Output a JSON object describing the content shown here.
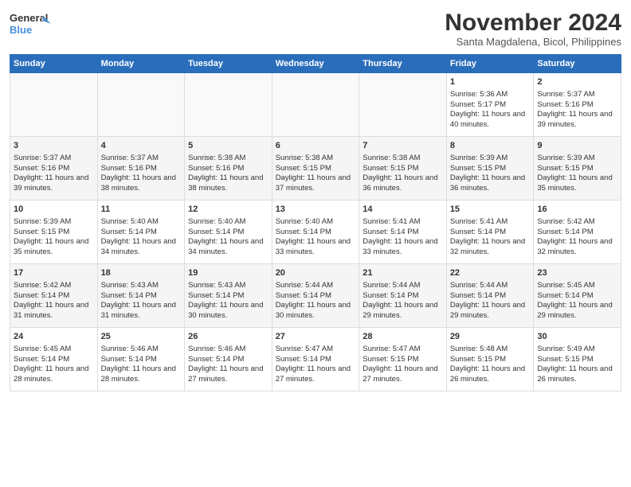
{
  "logo": {
    "line1": "General",
    "line2": "Blue"
  },
  "title": "November 2024",
  "subtitle": "Santa Magdalena, Bicol, Philippines",
  "days_of_week": [
    "Sunday",
    "Monday",
    "Tuesday",
    "Wednesday",
    "Thursday",
    "Friday",
    "Saturday"
  ],
  "weeks": [
    [
      {
        "day": "",
        "info": ""
      },
      {
        "day": "",
        "info": ""
      },
      {
        "day": "",
        "info": ""
      },
      {
        "day": "",
        "info": ""
      },
      {
        "day": "",
        "info": ""
      },
      {
        "day": "1",
        "info": "Sunrise: 5:36 AM\nSunset: 5:17 PM\nDaylight: 11 hours and 40 minutes."
      },
      {
        "day": "2",
        "info": "Sunrise: 5:37 AM\nSunset: 5:16 PM\nDaylight: 11 hours and 39 minutes."
      }
    ],
    [
      {
        "day": "3",
        "info": "Sunrise: 5:37 AM\nSunset: 5:16 PM\nDaylight: 11 hours and 39 minutes."
      },
      {
        "day": "4",
        "info": "Sunrise: 5:37 AM\nSunset: 5:16 PM\nDaylight: 11 hours and 38 minutes."
      },
      {
        "day": "5",
        "info": "Sunrise: 5:38 AM\nSunset: 5:16 PM\nDaylight: 11 hours and 38 minutes."
      },
      {
        "day": "6",
        "info": "Sunrise: 5:38 AM\nSunset: 5:15 PM\nDaylight: 11 hours and 37 minutes."
      },
      {
        "day": "7",
        "info": "Sunrise: 5:38 AM\nSunset: 5:15 PM\nDaylight: 11 hours and 36 minutes."
      },
      {
        "day": "8",
        "info": "Sunrise: 5:39 AM\nSunset: 5:15 PM\nDaylight: 11 hours and 36 minutes."
      },
      {
        "day": "9",
        "info": "Sunrise: 5:39 AM\nSunset: 5:15 PM\nDaylight: 11 hours and 35 minutes."
      }
    ],
    [
      {
        "day": "10",
        "info": "Sunrise: 5:39 AM\nSunset: 5:15 PM\nDaylight: 11 hours and 35 minutes."
      },
      {
        "day": "11",
        "info": "Sunrise: 5:40 AM\nSunset: 5:14 PM\nDaylight: 11 hours and 34 minutes."
      },
      {
        "day": "12",
        "info": "Sunrise: 5:40 AM\nSunset: 5:14 PM\nDaylight: 11 hours and 34 minutes."
      },
      {
        "day": "13",
        "info": "Sunrise: 5:40 AM\nSunset: 5:14 PM\nDaylight: 11 hours and 33 minutes."
      },
      {
        "day": "14",
        "info": "Sunrise: 5:41 AM\nSunset: 5:14 PM\nDaylight: 11 hours and 33 minutes."
      },
      {
        "day": "15",
        "info": "Sunrise: 5:41 AM\nSunset: 5:14 PM\nDaylight: 11 hours and 32 minutes."
      },
      {
        "day": "16",
        "info": "Sunrise: 5:42 AM\nSunset: 5:14 PM\nDaylight: 11 hours and 32 minutes."
      }
    ],
    [
      {
        "day": "17",
        "info": "Sunrise: 5:42 AM\nSunset: 5:14 PM\nDaylight: 11 hours and 31 minutes."
      },
      {
        "day": "18",
        "info": "Sunrise: 5:43 AM\nSunset: 5:14 PM\nDaylight: 11 hours and 31 minutes."
      },
      {
        "day": "19",
        "info": "Sunrise: 5:43 AM\nSunset: 5:14 PM\nDaylight: 11 hours and 30 minutes."
      },
      {
        "day": "20",
        "info": "Sunrise: 5:44 AM\nSunset: 5:14 PM\nDaylight: 11 hours and 30 minutes."
      },
      {
        "day": "21",
        "info": "Sunrise: 5:44 AM\nSunset: 5:14 PM\nDaylight: 11 hours and 29 minutes."
      },
      {
        "day": "22",
        "info": "Sunrise: 5:44 AM\nSunset: 5:14 PM\nDaylight: 11 hours and 29 minutes."
      },
      {
        "day": "23",
        "info": "Sunrise: 5:45 AM\nSunset: 5:14 PM\nDaylight: 11 hours and 29 minutes."
      }
    ],
    [
      {
        "day": "24",
        "info": "Sunrise: 5:45 AM\nSunset: 5:14 PM\nDaylight: 11 hours and 28 minutes."
      },
      {
        "day": "25",
        "info": "Sunrise: 5:46 AM\nSunset: 5:14 PM\nDaylight: 11 hours and 28 minutes."
      },
      {
        "day": "26",
        "info": "Sunrise: 5:46 AM\nSunset: 5:14 PM\nDaylight: 11 hours and 27 minutes."
      },
      {
        "day": "27",
        "info": "Sunrise: 5:47 AM\nSunset: 5:14 PM\nDaylight: 11 hours and 27 minutes."
      },
      {
        "day": "28",
        "info": "Sunrise: 5:47 AM\nSunset: 5:15 PM\nDaylight: 11 hours and 27 minutes."
      },
      {
        "day": "29",
        "info": "Sunrise: 5:48 AM\nSunset: 5:15 PM\nDaylight: 11 hours and 26 minutes."
      },
      {
        "day": "30",
        "info": "Sunrise: 5:49 AM\nSunset: 5:15 PM\nDaylight: 11 hours and 26 minutes."
      }
    ]
  ]
}
